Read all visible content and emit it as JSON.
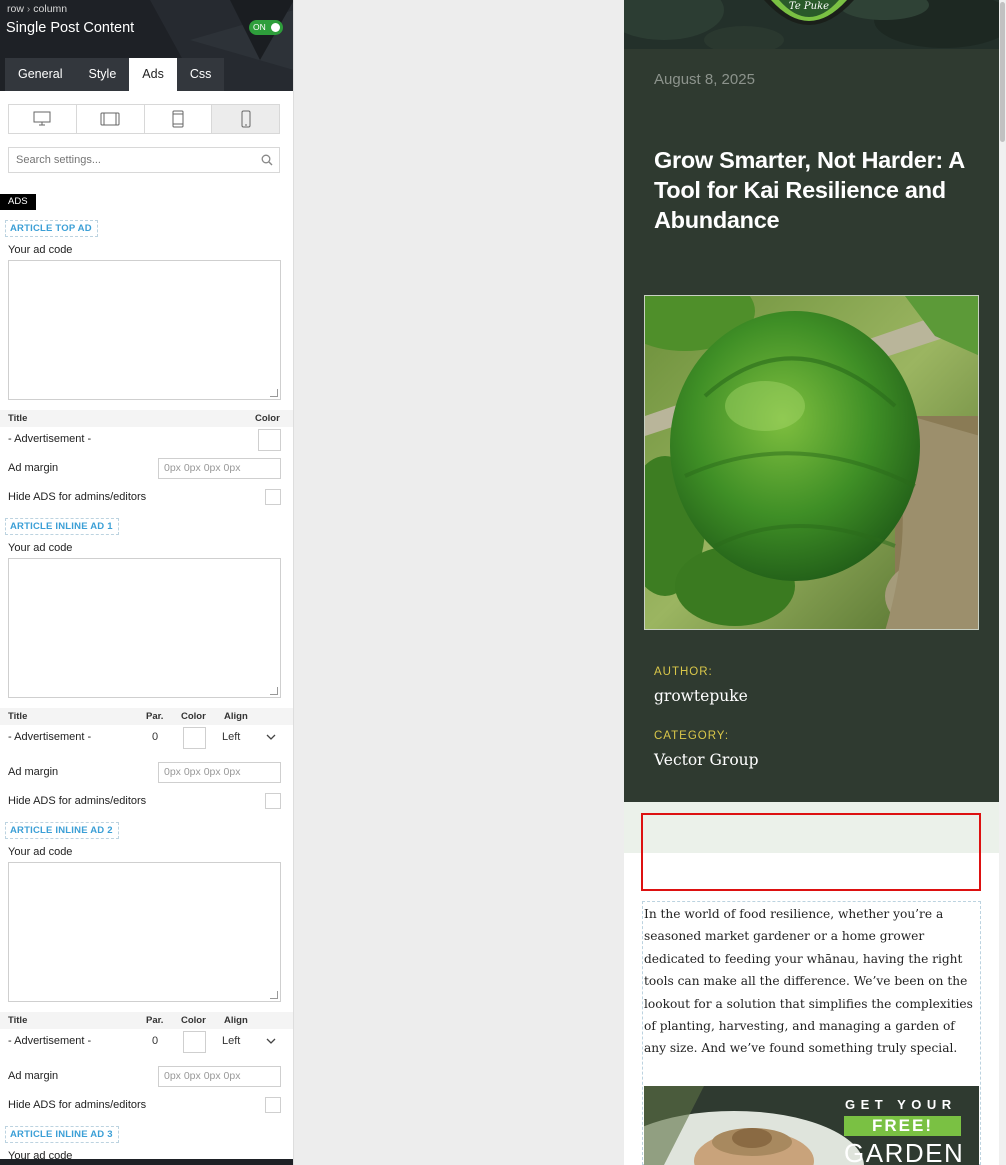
{
  "panel": {
    "breadcrumb": [
      "row",
      "column"
    ],
    "title": "Single Post Content",
    "toggle_label": "ON",
    "tabs": [
      "General",
      "Style",
      "Ads",
      "Css"
    ],
    "active_tab": "Ads",
    "devices": [
      "desktop-icon",
      "tablet-landscape-icon",
      "tablet-portrait-icon",
      "phone-icon"
    ],
    "search_placeholder": "Search settings...",
    "ads_badge": "ADS",
    "sections": [
      {
        "tag": "ARTICLE TOP AD",
        "code_label": "Your ad code",
        "col_title": "Title",
        "col_color": "Color",
        "title_value": "- Advertisement -",
        "margin_label": "Ad margin",
        "margin_placeholder": "0px 0px 0px 0px",
        "hide_label": "Hide ADS for admins/editors"
      },
      {
        "tag": "ARTICLE INLINE AD 1",
        "code_label": "Your ad code",
        "col_title": "Title",
        "col_par": "Par.",
        "col_color": "Color",
        "col_align": "Align",
        "title_value": "- Advertisement -",
        "par_value": "0",
        "align_value": "Left",
        "margin_label": "Ad margin",
        "margin_placeholder": "0px 0px 0px 0px",
        "hide_label": "Hide ADS for admins/editors"
      },
      {
        "tag": "ARTICLE INLINE AD 2",
        "code_label": "Your ad code",
        "col_title": "Title",
        "col_par": "Par.",
        "col_color": "Color",
        "col_align": "Align",
        "title_value": "- Advertisement -",
        "par_value": "0",
        "align_value": "Left",
        "margin_label": "Ad margin",
        "margin_placeholder": "0px 0px 0px 0px",
        "hide_label": "Hide ADS for admins/editors"
      },
      {
        "tag": "ARTICLE INLINE AD 3",
        "code_label": "Your ad code"
      }
    ]
  },
  "preview": {
    "date": "August 8, 2025",
    "title": "Grow Smarter, Not Harder: A Tool for Kai Resilience and Abundance",
    "author_label": "AUTHOR:",
    "author_value": "growtepuke",
    "category_label": "CATEGORY:",
    "category_value": "Vector Group",
    "body_text": "In the world of food resilience, whether you’re a seasoned market gardener or a home grower dedicated to feeding your whānau, having the right tools can make all the difference. We’ve been on the lookout for a solution that simplifies the complexities of planting, harvesting, and managing a garden of any size. And we’ve found something truly special.",
    "promo_line1": "GET YOUR",
    "promo_free": "FREE!",
    "promo_garden": "GARDEN",
    "logo_text": "Te Puke"
  },
  "colors": {
    "panel_header": "#1e2126",
    "toggle_on": "#2e9e3b",
    "section_tag": "#3b9fd6",
    "preview_dark": "#2f3a30",
    "meta_label": "#d9c74a",
    "ad_highlight": "#dd1111",
    "promo_green": "#7ac143"
  }
}
